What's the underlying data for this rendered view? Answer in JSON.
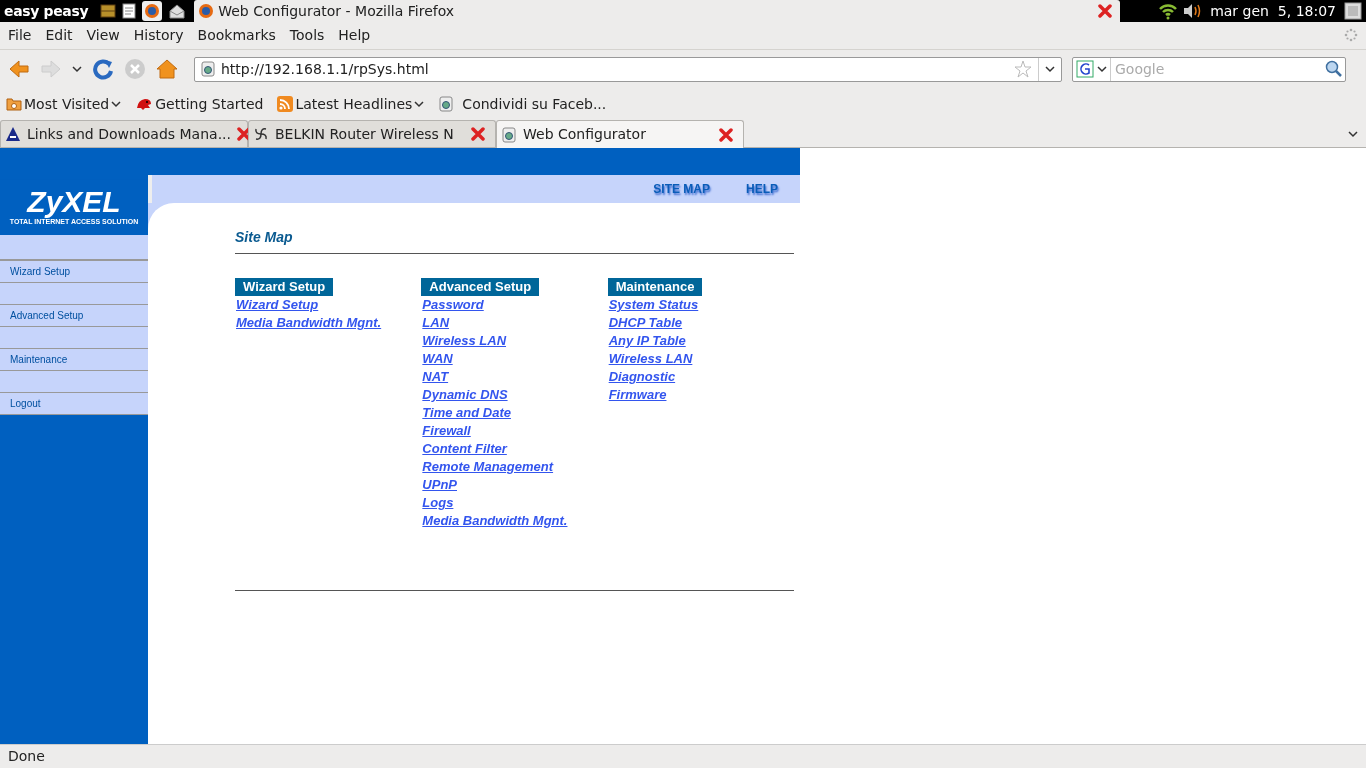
{
  "panel": {
    "logo": "easy peasy",
    "window_title": "Web Configurator - Mozilla Firefox",
    "clock": "mar gen  5, 18:07"
  },
  "menu": [
    "File",
    "Edit",
    "View",
    "History",
    "Bookmarks",
    "Tools",
    "Help"
  ],
  "url": "http://192.168.1.1/rpSys.html",
  "search": {
    "placeholder": "Google"
  },
  "bookmarks": [
    {
      "label": "Most Visited",
      "kind": "folder",
      "dropdown": true
    },
    {
      "label": "Getting Started",
      "kind": "dino",
      "dropdown": false
    },
    {
      "label": "Latest Headlines",
      "kind": "rss",
      "dropdown": true
    },
    {
      "label": "Condividi su Faceb...",
      "kind": "page",
      "dropdown": false
    }
  ],
  "tabs": [
    {
      "label": "Links and Downloads Mana...",
      "kind": "letter",
      "selected": false
    },
    {
      "label": "BELKIN Router Wireless N",
      "kind": "swirl",
      "selected": false
    },
    {
      "label": "Web Configurator",
      "kind": "page",
      "selected": true
    }
  ],
  "router": {
    "logo": "ZyXEL",
    "tagline": "TOTAL INTERNET ACCESS SOLUTION",
    "top_links": [
      "SITE MAP",
      "HELP"
    ],
    "sidebar": [
      "Wizard Setup",
      "Advanced Setup",
      "Maintenance",
      "Logout"
    ],
    "title": "Site Map",
    "columns": [
      {
        "heading": "Wizard Setup",
        "links": [
          "Wizard Setup",
          "Media Bandwidth Mgnt."
        ]
      },
      {
        "heading": "Advanced Setup",
        "links": [
          "Password",
          "LAN",
          "Wireless LAN",
          "WAN",
          "NAT",
          "Dynamic DNS",
          "Time and Date",
          "Firewall",
          "Content Filter",
          "Remote Management",
          "UPnP",
          "Logs",
          "Media Bandwidth Mgnt."
        ]
      },
      {
        "heading": "Maintenance",
        "links": [
          "System Status",
          "DHCP Table",
          "Any IP Table",
          "Wireless LAN",
          "Diagnostic",
          "Firmware"
        ]
      }
    ]
  },
  "status_bar": "Done"
}
